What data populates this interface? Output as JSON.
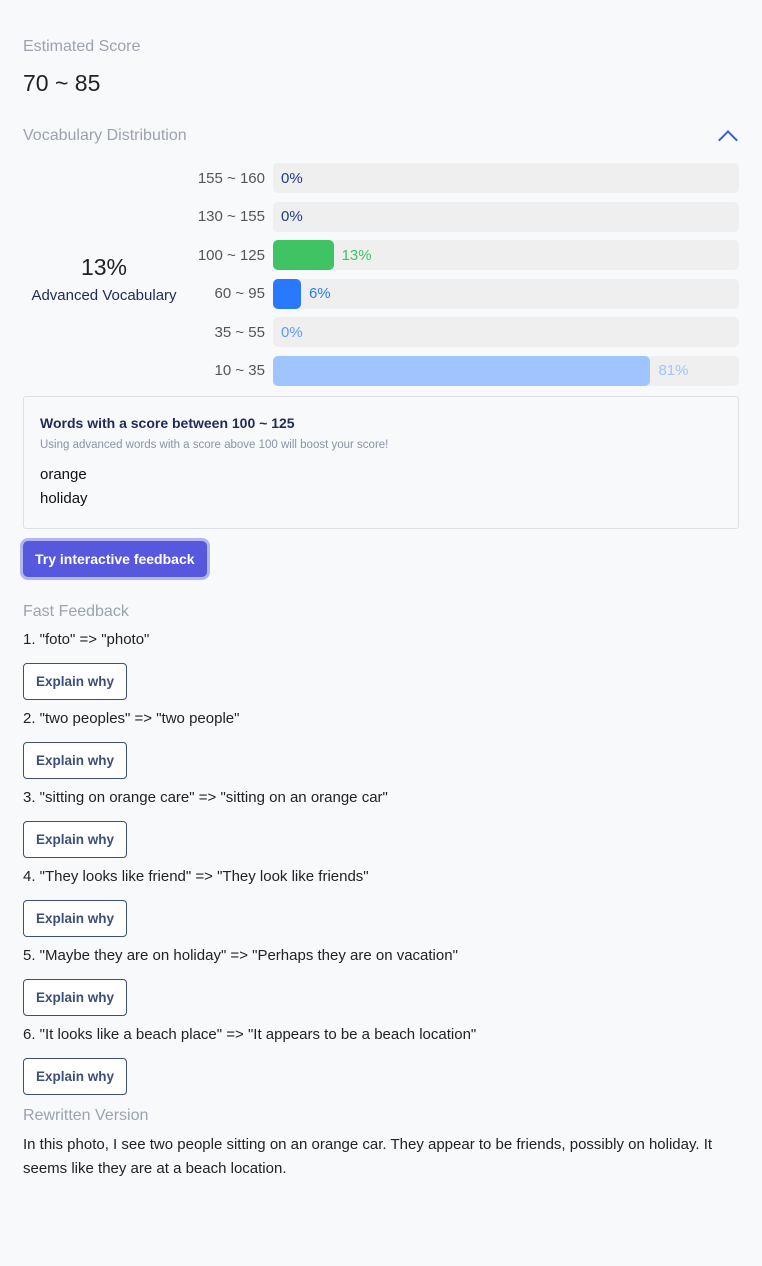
{
  "estimated": {
    "label": "Estimated Score",
    "value": "70 ~ 85"
  },
  "vocab": {
    "label": "Vocabulary Distribution",
    "collapse_icon": "chevron-up-icon",
    "advanced_pct": "13%",
    "advanced_label": "Advanced Vocabulary",
    "rows": [
      {
        "range": "155 ~ 160",
        "percent": 0,
        "label": "0%",
        "color": "#1e3a8a"
      },
      {
        "range": "130 ~ 155",
        "percent": 0,
        "label": "0%",
        "color": "#1e3a8a"
      },
      {
        "range": "100 ~ 125",
        "percent": 13,
        "label": "13%",
        "color": "#40c463"
      },
      {
        "range": "60 ~ 95",
        "percent": 6,
        "label": "6%",
        "color": "#2979ff"
      },
      {
        "range": "35 ~ 55",
        "percent": 0,
        "label": "0%",
        "color": "#5b9bff"
      },
      {
        "range": "10 ~ 35",
        "percent": 81,
        "label": "81%",
        "color": "#a0c4fd"
      }
    ]
  },
  "words": {
    "title": "Words with a score between 100 ~ 125",
    "subtitle": "Using advanced words with a score above 100 will boost your score!",
    "list": [
      "orange",
      "holiday"
    ]
  },
  "try_button": "Try interactive feedback",
  "fast_feedback": {
    "label": "Fast Feedback",
    "explain_label": "Explain why",
    "items": [
      "1. \"foto\" => \"photo\"",
      "2. \"two peoples\" => \"two people\"",
      "3. \"sitting on orange care\" => \"sitting on an orange car\"",
      "4. \"They looks like friend\" => \"They look like friends\"",
      "5. \"Maybe they are on holiday\" => \"Perhaps they are on vacation\"",
      "6. \"It looks like a beach place\" => \"It appears to be a beach location\""
    ]
  },
  "rewritten": {
    "label": "Rewritten Version",
    "text": "In this photo, I see two people sitting on an orange car. They appear to be friends, possibly on holiday. It seems like they are at a beach location."
  }
}
